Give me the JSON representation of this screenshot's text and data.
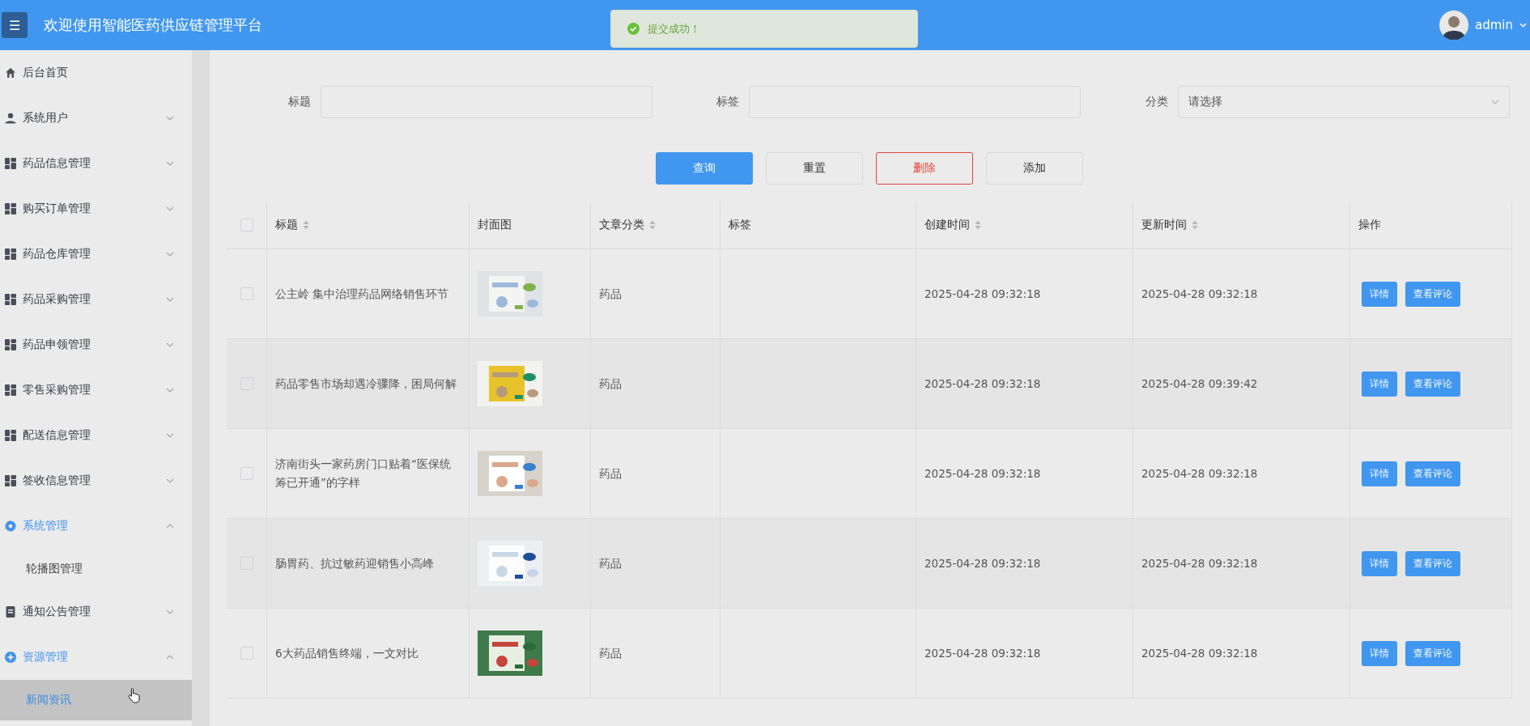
{
  "header": {
    "title": "欢迎使用智能医药供应链管理平台",
    "menu_toggle": "☰",
    "user": "admin"
  },
  "toast": {
    "message": "提交成功！"
  },
  "sidebar": {
    "items": [
      {
        "label": "后台首页",
        "kind": "home"
      },
      {
        "label": "系统用户",
        "kind": "user",
        "expanded": false
      },
      {
        "label": "药品信息管理",
        "kind": "grid",
        "expanded": false
      },
      {
        "label": "购买订单管理",
        "kind": "grid",
        "expanded": false
      },
      {
        "label": "药品仓库管理",
        "kind": "grid",
        "expanded": false
      },
      {
        "label": "药品采购管理",
        "kind": "grid",
        "expanded": false
      },
      {
        "label": "药品申领管理",
        "kind": "grid",
        "expanded": false
      },
      {
        "label": "零售采购管理",
        "kind": "grid",
        "expanded": false
      },
      {
        "label": "配送信息管理",
        "kind": "grid",
        "expanded": false
      },
      {
        "label": "签收信息管理",
        "kind": "grid",
        "expanded": false
      },
      {
        "label": "系统管理",
        "kind": "gear",
        "expanded": true,
        "children": [
          {
            "label": "轮播图管理",
            "selected": false
          }
        ]
      },
      {
        "label": "通知公告管理",
        "kind": "doc",
        "expanded": false
      },
      {
        "label": "资源管理",
        "kind": "star",
        "expanded": true,
        "children": [
          {
            "label": "新闻资讯",
            "selected": true
          }
        ]
      }
    ]
  },
  "filters": [
    {
      "label": "标题",
      "kind": "text"
    },
    {
      "label": "标签",
      "kind": "text"
    },
    {
      "label": "分类",
      "kind": "select",
      "placeholder": "请选择"
    }
  ],
  "buttons": [
    {
      "label": "查询",
      "kind": "primary"
    },
    {
      "label": "重置",
      "kind": "default"
    },
    {
      "label": "删除",
      "kind": "danger"
    },
    {
      "label": "添加",
      "kind": "default"
    }
  ],
  "table": {
    "all_checked": false,
    "columns": [
      {
        "label": "标题",
        "sortable": true
      },
      {
        "label": "封面图",
        "sortable": false
      },
      {
        "label": "文章分类",
        "sortable": true
      },
      {
        "label": "标签",
        "sortable": false
      },
      {
        "label": "创建时间",
        "sortable": true
      },
      {
        "label": "更新时间",
        "sortable": true
      },
      {
        "label": "操作",
        "sortable": false
      }
    ],
    "rows": [
      {
        "checked": false,
        "title": "公主岭 集中治理药品网络销售环节",
        "cover": {
          "kind": "picture"
        },
        "category": "药品",
        "created": "2025-04-28 09:32:18",
        "updated": "2025-04-28 09:32:18",
        "actions": [
          "详情",
          "查看评论"
        ]
      },
      {
        "checked": false,
        "title": "药品零售市场却遇冷骤降，困局何解",
        "cover": {
          "kind": "picture"
        },
        "category": "药品",
        "created": "2025-04-28 09:32:18",
        "updated": "2025-04-28 09:39:42",
        "actions": [
          "详情",
          "查看评论"
        ]
      },
      {
        "checked": false,
        "title": "济南街头一家药房门口贴着“医保统筹已开通”的字样",
        "cover": {
          "kind": "picture"
        },
        "category": "药品",
        "created": "2025-04-28 09:32:18",
        "updated": "2025-04-28 09:32:18",
        "actions": [
          "详情",
          "查看评论"
        ]
      },
      {
        "checked": false,
        "title": "肠胃药、抗过敏药迎销售小高峰",
        "cover": {
          "kind": "picture"
        },
        "category": "药品",
        "created": "2025-04-28 09:32:18",
        "updated": "2025-04-28 09:32:18",
        "actions": [
          "详情",
          "查看评论"
        ]
      },
      {
        "checked": false,
        "title": "6大药品销售终端，一文对比",
        "cover": {
          "kind": "picture"
        },
        "category": "药品",
        "created": "2025-04-28 09:32:18",
        "updated": "2025-04-28 09:32:18",
        "actions": [
          "详情",
          "查看评论"
        ]
      }
    ]
  }
}
